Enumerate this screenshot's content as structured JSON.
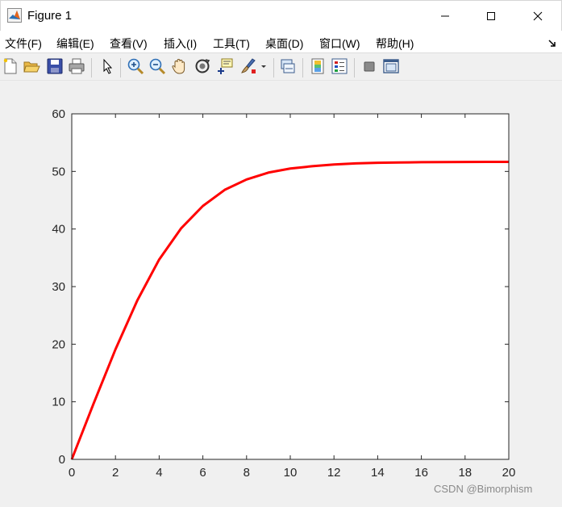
{
  "window": {
    "title": "Figure 1",
    "icon": "matlab-icon",
    "controls": [
      "minimize-icon",
      "maximize-icon",
      "close-icon"
    ]
  },
  "menu": [
    "文件(F)",
    "编辑(E)",
    "查看(V)",
    "插入(I)",
    "工具(T)",
    "桌面(D)",
    "窗口(W)",
    "帮助(H)"
  ],
  "toolbar": [
    "new-figure-icon",
    "open-file-icon",
    "save-icon",
    "print-icon",
    "edit-plot-arrow-icon",
    "zoom-in-icon",
    "zoom-out-icon",
    "pan-hand-icon",
    "rotate-3d-icon",
    "data-cursor-icon",
    "brush-icon",
    "brush-dropdown-icon",
    "link-plot-icon",
    "insert-colorbar-icon",
    "insert-legend-icon",
    "hide-plot-tools-icon",
    "show-plot-tools-icon"
  ],
  "chart_data": {
    "type": "line",
    "x": [
      0,
      1,
      2,
      3,
      4,
      5,
      6,
      7,
      8,
      9,
      10,
      11,
      12,
      13,
      14,
      15,
      16,
      17,
      18,
      19,
      20
    ],
    "series": [
      {
        "color": "#ff0000",
        "values": [
          0,
          9.7,
          19.1,
          27.6,
          34.7,
          40.1,
          44.0,
          46.8,
          48.6,
          49.8,
          50.5,
          50.9,
          51.2,
          51.4,
          51.5,
          51.55,
          51.6,
          51.62,
          51.64,
          51.65,
          51.66
        ]
      }
    ],
    "xlim": [
      0,
      20
    ],
    "ylim": [
      0,
      60
    ],
    "xticks": [
      "0",
      "2",
      "4",
      "6",
      "8",
      "10",
      "12",
      "14",
      "16",
      "18",
      "20"
    ],
    "yticks": [
      "0",
      "10",
      "20",
      "30",
      "40",
      "50",
      "60"
    ],
    "grid": false,
    "title": "",
    "xlabel": "",
    "ylabel": ""
  },
  "watermark": "CSDN @Bimorphism"
}
